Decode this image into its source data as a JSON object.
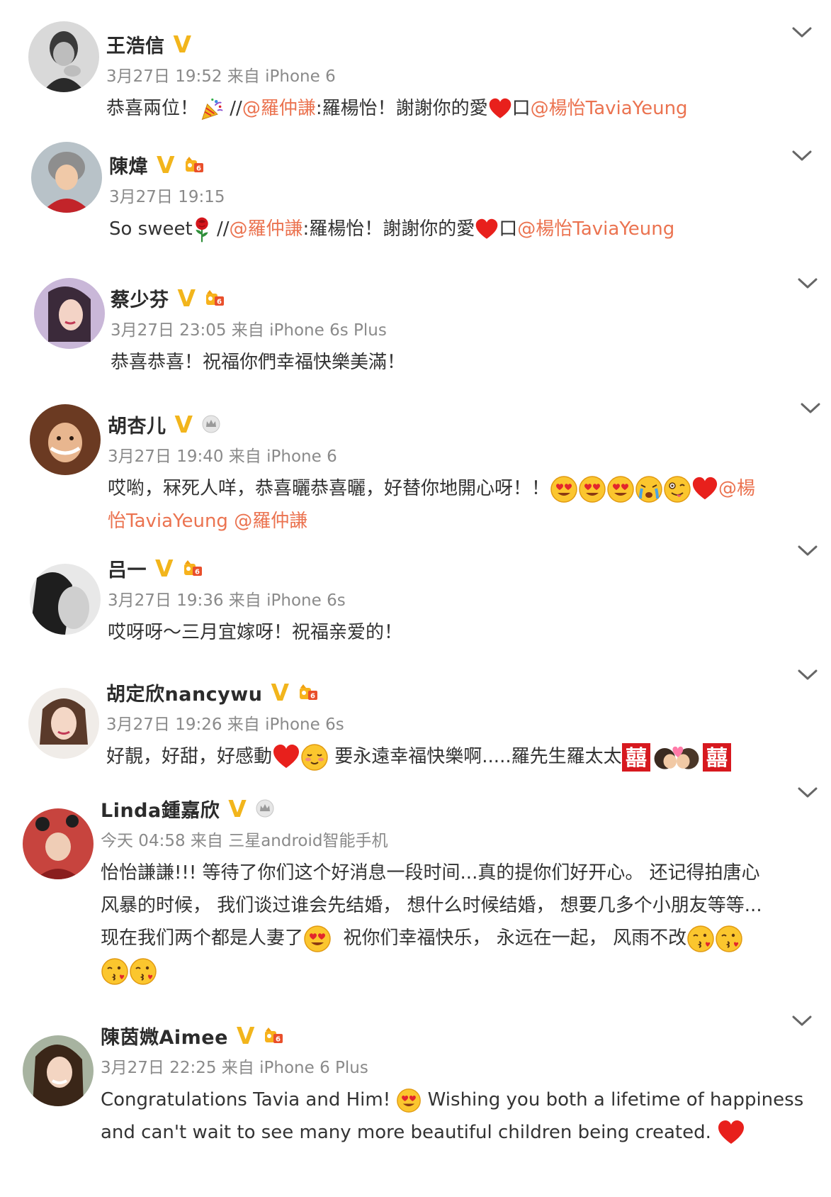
{
  "posts": [
    {
      "user": "王浩信",
      "badge": "V",
      "meta": "3月27日 19:52 来自 iPhone 6",
      "text_a": "恭喜兩位！",
      "sep": "//",
      "mention_1": "@羅仲謙",
      "text_b": ":羅楊怡！謝謝你的愛",
      "box": "口",
      "mention_2": "@楊怡TaviaYeung",
      "icons": [
        "party-popper-emoji",
        "red-heart-emoji"
      ]
    },
    {
      "user": "陳煒",
      "badge": "V",
      "meta": "3月27日 19:15",
      "text_a": "So sweet",
      "sep": "//",
      "mention_1": "@羅仲謙",
      "text_b": ":羅楊怡！謝謝你的愛",
      "box": "口",
      "mention_2": "@楊怡TaviaYeung",
      "icons": [
        "rose-emoji",
        "red-heart-emoji"
      ]
    },
    {
      "user": "蔡少芬",
      "badge": "V",
      "meta": "3月27日 23:05 来自 iPhone 6s Plus",
      "text_a": "恭喜恭喜！祝福你們幸福快樂美滿！"
    },
    {
      "user": "胡杏儿",
      "badge": "V",
      "meta": "3月27日 19:40 来自 iPhone 6",
      "text_a": "哎喲，冧死人咩，恭喜曬恭喜曬，好替你地開心呀！！",
      "mention_1": "@楊",
      "mention_2": "怡TaviaYeung",
      "mention_3": "@羅仲謙",
      "icons": [
        "heart-eyes-emoji",
        "heart-eyes-emoji",
        "heart-eyes-emoji",
        "crying-emoji",
        "silly-emoji",
        "red-heart-emoji"
      ]
    },
    {
      "user": "吕一",
      "badge": "V",
      "meta": "3月27日 19:36 来自 iPhone 6s",
      "text_a": "哎呀呀～三月宜嫁呀！祝福亲爱的！"
    },
    {
      "user": "胡定欣nancywu",
      "badge": "V",
      "meta": "3月27日 19:26 来自 iPhone 6s",
      "text_a": "好靚，好甜，好感動",
      "text_b": "要永遠幸福快樂啊.....羅先生羅太太",
      "icons": [
        "red-heart-emoji",
        "blushing-emoji",
        "double-happiness-emoji",
        "kissing-couple-emoji",
        "double-happiness-emoji"
      ]
    },
    {
      "user": "Linda鍾嘉欣",
      "badge": "V",
      "meta": "今天 04:58 来自 三星android智能手机",
      "line_1": "怡怡謙謙!!! 等待了你们这个好消息一段时间...真的提你们好开心。 还记得拍唐心",
      "line_2": "风暴的时候， 我们谈过谁会先结婚， 想什么时候结婚， 想要几多个小朋友等等...",
      "line_3a": "现在我们两个都是人妻了",
      "line_3b": "祝你们幸福快乐， 永远在一起， 风雨不改",
      "icons": [
        "heart-eyes-emoji",
        "kissing-heart-emoji",
        "kissing-heart-emoji",
        "kissing-heart-emoji",
        "kissing-heart-emoji"
      ]
    },
    {
      "user": "陳茵媺Aimee",
      "badge": "V",
      "meta": "3月27日 22:25 来自 iPhone 6 Plus",
      "line_1a": "Congratulations Tavia and Him!",
      "line_1b": "Wishing you both a lifetime of happiness",
      "line_2": "and can't wait to see many more beautiful children being created.",
      "icons": [
        "heart-eyes-emoji",
        "red-heart-emoji"
      ]
    }
  ],
  "colors": {
    "mention": "#eb7350",
    "badge": "#f2b51c",
    "meta": "#8a8a8a",
    "text": "#333333"
  }
}
